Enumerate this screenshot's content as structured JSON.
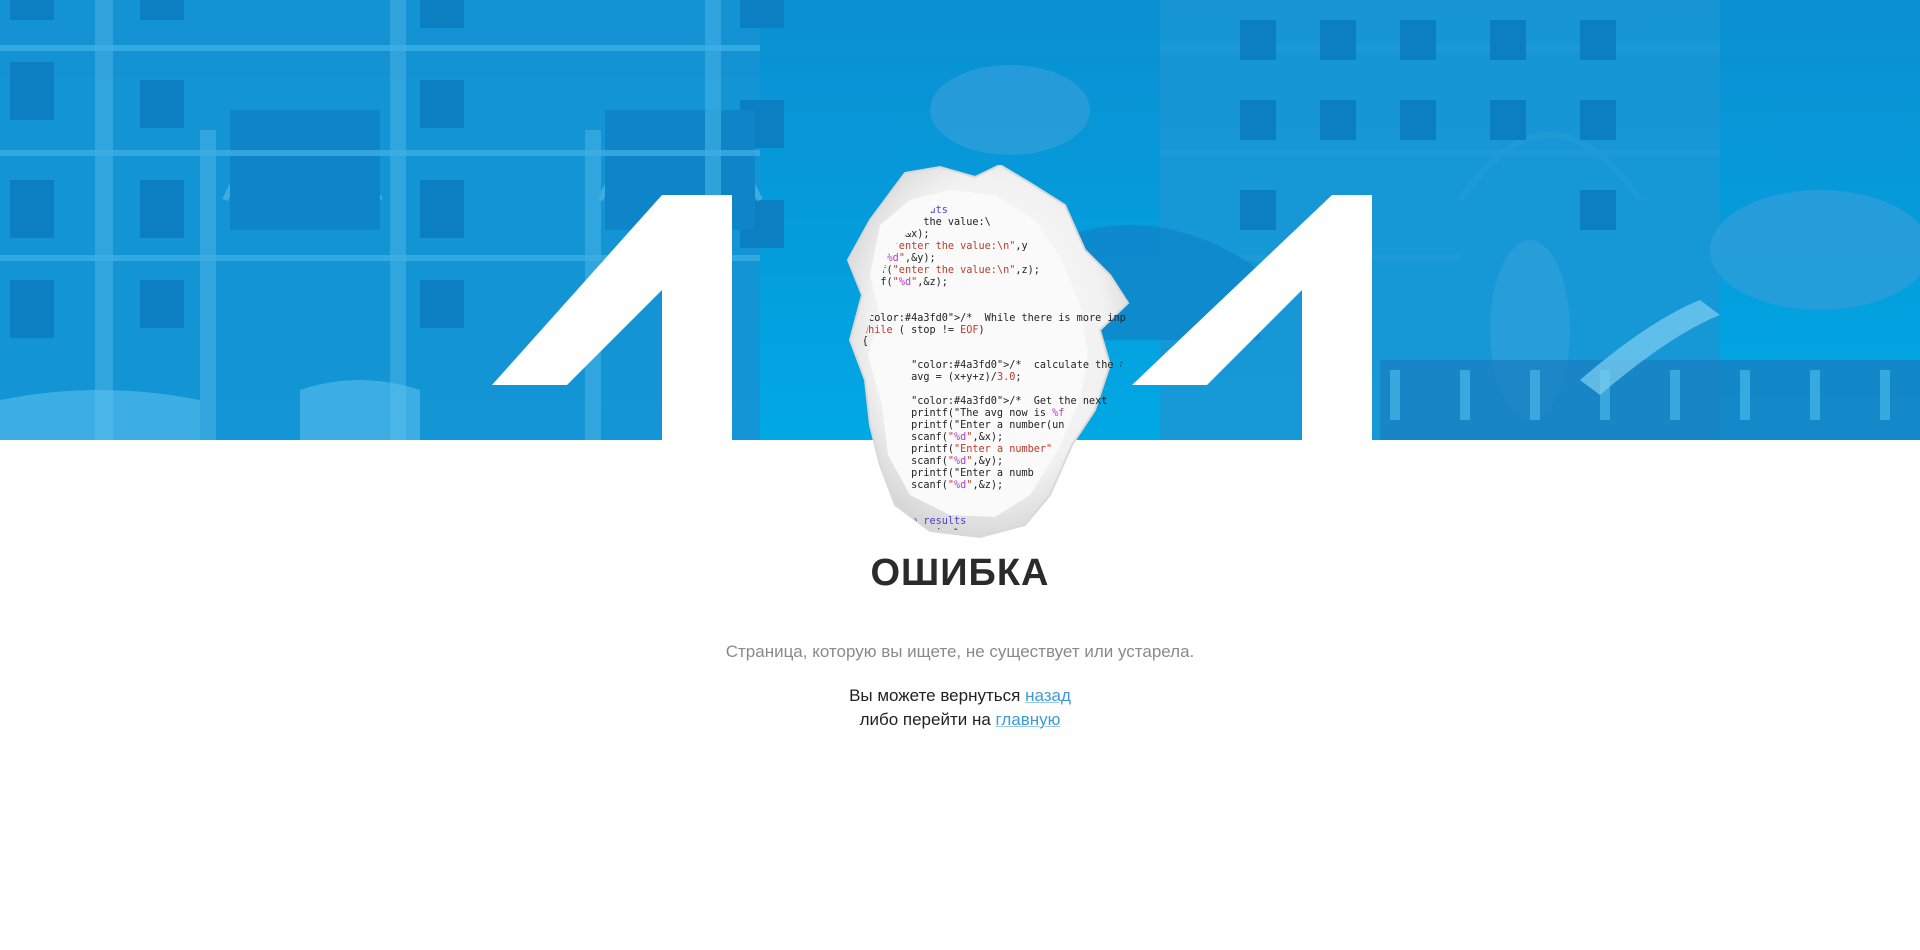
{
  "hero": {
    "accent": "#00a3e0",
    "digit_left": "4",
    "digit_right": "4"
  },
  "code_snippet": {
    "lines": [
      "        inputs",
      "     nter the value:\\",
      "     \",&x);",
      "     \"enter the value:\\n\",y",
      "   \"%d\",&y);",
      "   f(\"enter the value:\\n\",z);",
      "  nf(\"%d\",&z);",
      "",
      "",
      "/*  While there is more input      */",
      "while ( stop != EOF)",
      "{",
      "",
      "        /*  calculate the average",
      "        avg = (x+y+z)/3.0;",
      "",
      "        /*  Get the next set of inp",
      "        printf(\"The avg now is %f",
      "        printf(\"Enter a number(un",
      "        scanf(\"%d\",&x);",
      "        printf(\"Enter a number\"",
      "        scanf(\"%d\",&y);",
      "        printf(\"Enter a numb",
      "        scanf(\"%d\",&z);",
      "",
      "",
      "      the results",
      "        avg is %"
    ]
  },
  "error": {
    "title": "ОШИБКА",
    "description": "Страница, которую вы ищете, не существует или устарела.",
    "back_prefix": "Вы можете вернуться",
    "back_link": "назад",
    "home_prefix": "либо перейти на",
    "home_link": "главную",
    "link_color": "#3d9bd6"
  }
}
